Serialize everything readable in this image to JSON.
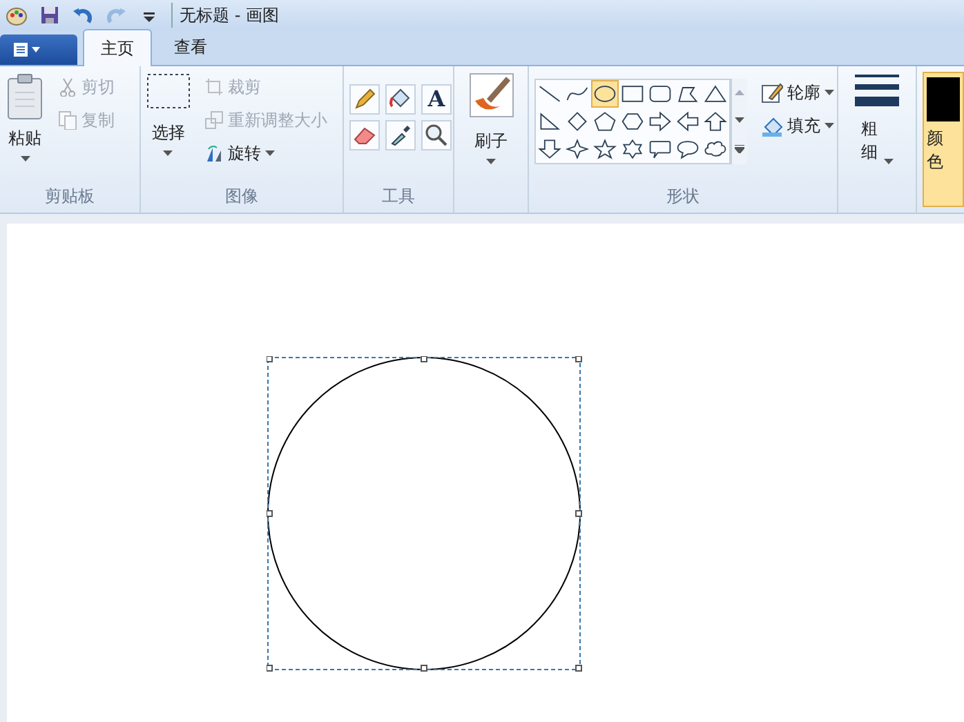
{
  "window": {
    "title": "无标题 - 画图"
  },
  "quick_access": [
    {
      "kind": "save",
      "disabled": false
    },
    {
      "kind": "undo",
      "disabled": false
    },
    {
      "kind": "redo",
      "disabled": true
    },
    {
      "kind": "customize",
      "disabled": false
    }
  ],
  "tabs": [
    {
      "label": "主页",
      "selected": true
    },
    {
      "label": "查看",
      "selected": false
    }
  ],
  "clipboard": {
    "label": "剪贴板",
    "paste": "粘贴",
    "items": [
      {
        "kind": "cut",
        "label": "剪切",
        "disabled": true
      },
      {
        "kind": "copy",
        "label": "复制",
        "disabled": true
      }
    ]
  },
  "image": {
    "label": "图像",
    "select": "选择",
    "items": [
      {
        "kind": "crop",
        "label": "裁剪",
        "disabled": true
      },
      {
        "kind": "resize",
        "label": "重新调整大小",
        "disabled": true
      },
      {
        "kind": "rotate",
        "label": "旋转",
        "disabled": false
      }
    ]
  },
  "tools": {
    "label": "工具",
    "items": [
      {
        "kind": "pencil",
        "selected": false
      },
      {
        "kind": "fill",
        "selected": false
      },
      {
        "kind": "text",
        "selected": false,
        "glyph": "A"
      },
      {
        "kind": "eraser",
        "selected": false
      },
      {
        "kind": "picker",
        "selected": false
      },
      {
        "kind": "magnifier",
        "selected": false
      }
    ]
  },
  "brushes": {
    "button": "刷子"
  },
  "shapes": {
    "label": "形状",
    "outline": "轮廓",
    "fill": "填充",
    "items": [
      {
        "kind": "line",
        "selected": false
      },
      {
        "kind": "curve",
        "selected": false
      },
      {
        "kind": "oval",
        "selected": true
      },
      {
        "kind": "rectangle",
        "selected": false
      },
      {
        "kind": "rounded-rectangle",
        "selected": false
      },
      {
        "kind": "polygon",
        "selected": false
      },
      {
        "kind": "triangle",
        "selected": false
      },
      {
        "kind": "right-triangle",
        "selected": false
      },
      {
        "kind": "diamond",
        "selected": false
      },
      {
        "kind": "pentagon",
        "selected": false
      },
      {
        "kind": "hexagon",
        "selected": false
      },
      {
        "kind": "right-arrow",
        "selected": false
      },
      {
        "kind": "left-arrow",
        "selected": false
      },
      {
        "kind": "up-arrow",
        "selected": false
      },
      {
        "kind": "down-arrow",
        "selected": false
      },
      {
        "kind": "four-point-star",
        "selected": false
      },
      {
        "kind": "five-point-star",
        "selected": false
      },
      {
        "kind": "six-point-star",
        "selected": false
      },
      {
        "kind": "rounded-callout",
        "selected": false
      },
      {
        "kind": "oval-callout",
        "selected": false
      },
      {
        "kind": "cloud-callout",
        "selected": false
      }
    ]
  },
  "size": {
    "button": "粗细"
  },
  "color1": {
    "label": "颜色",
    "selected": true
  },
  "canvas": {
    "selected": true
  }
}
